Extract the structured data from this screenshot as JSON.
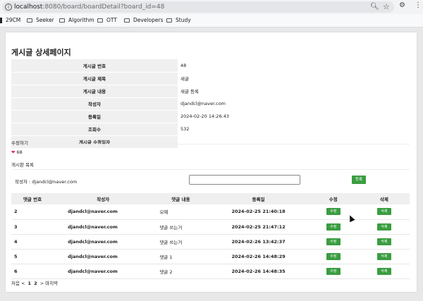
{
  "browser": {
    "url_host": "localhost",
    "url_rest": ":8080/board/boardDetail?board_id=48",
    "bookmarks": [
      "29CM",
      "Seeker",
      "Algorithm",
      "OTT",
      "Developers",
      "Study"
    ]
  },
  "page": {
    "title": "게시글 상세페이지",
    "detail_rows": [
      {
        "label": "게시글 번호",
        "value": "48"
      },
      {
        "label": "게시글 제목",
        "value": "새글"
      },
      {
        "label": "게시글 내용",
        "value": "새글 등록"
      },
      {
        "label": "작성자",
        "value": "djandcl@naver.com"
      },
      {
        "label": "등록일",
        "value": "2024-02-20 14:26:43"
      },
      {
        "label": "조회수",
        "value": "532"
      },
      {
        "label": "게시글 수정일자",
        "value": ""
      }
    ],
    "edit_link": "수정하기",
    "like_count": "68",
    "list_link": "게시판 목록",
    "comment_form": {
      "writer_label": "작성자 : djandcl@naver.com",
      "input_value": "",
      "submit_label": "등록"
    },
    "comments": {
      "headers": [
        "댓글 번호",
        "작성자",
        "댓글 내용",
        "등록일",
        "수정",
        "삭제"
      ],
      "edit_label": "수정",
      "delete_label": "삭제",
      "rows": [
        {
          "no": "2",
          "writer": "djandcl@naver.com",
          "content": "오예",
          "date": "2024-02-25 21:40:18"
        },
        {
          "no": "3",
          "writer": "djandcl@naver.com",
          "content": "댓글 쓰는거",
          "date": "2024-02-25 21:47:12"
        },
        {
          "no": "4",
          "writer": "djandcl@naver.com",
          "content": "댓글 쓰는거",
          "date": "2024-02-26 13:42:37"
        },
        {
          "no": "5",
          "writer": "djandcl@naver.com",
          "content": "댓글 1",
          "date": "2024-02-26 14:48:29"
        },
        {
          "no": "6",
          "writer": "djandcl@naver.com",
          "content": "댓글 2",
          "date": "2024-02-26 14:48:35"
        }
      ]
    },
    "pagination": {
      "first": "처음",
      "prev": "<",
      "pages": [
        "1",
        "2"
      ],
      "next": ">",
      "last": "마지막"
    }
  }
}
